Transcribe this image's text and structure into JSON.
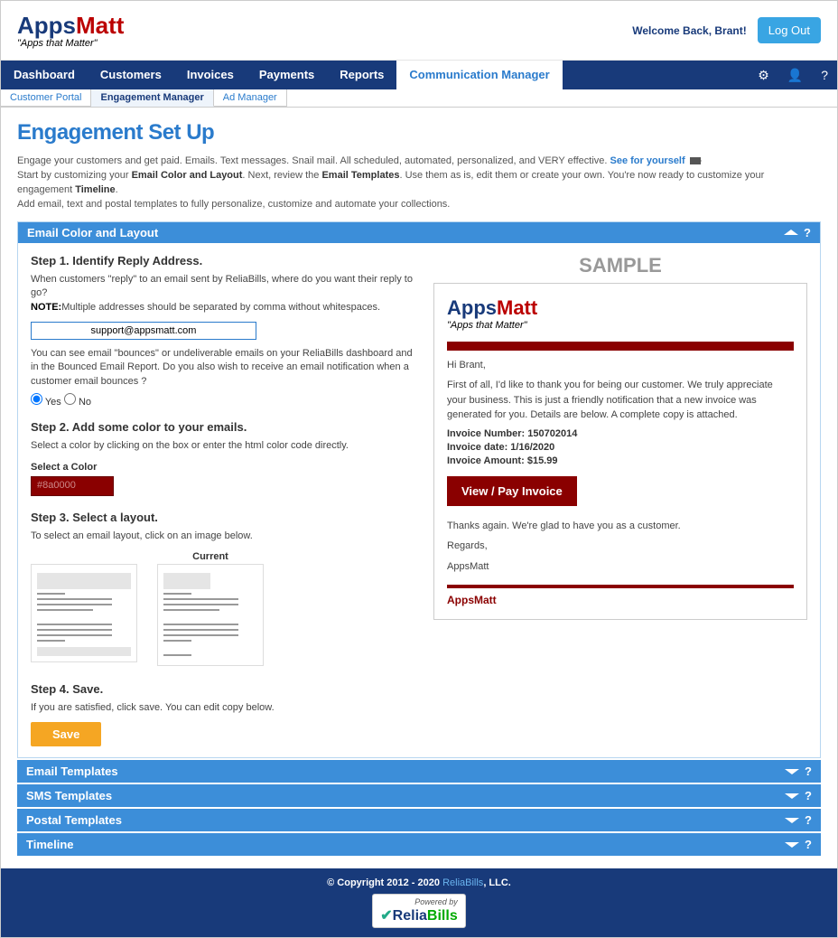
{
  "brand": {
    "apps": "Apps",
    "matt": "Matt",
    "tagline": "\"Apps that Matter\""
  },
  "header": {
    "welcome": "Welcome Back, Brant!",
    "logout": "Log Out"
  },
  "nav": {
    "items": [
      "Dashboard",
      "Customers",
      "Invoices",
      "Payments",
      "Reports",
      "Communication Manager"
    ],
    "active": 5
  },
  "subnav": {
    "items": [
      "Customer Portal",
      "Engagement Manager",
      "Ad Manager"
    ],
    "active": 1
  },
  "page": {
    "title": "Engagement Set Up",
    "intro1": "Engage your customers and get paid. Emails. Text messages. Snail mail. All scheduled, automated, personalized, and VERY effective. ",
    "see": "See for yourself",
    "intro2a": "Start by customizing your ",
    "intro2b": "Email Color and Layout",
    "intro2c": ". Next, review the ",
    "intro2d": "Email Templates",
    "intro2e": ". Use them as is, edit them or create your own. You're now ready to customize your engagement ",
    "intro2f": "Timeline",
    "intro2g": ".",
    "intro3": "Add email, text and postal templates to fully personalize, customize and automate your collections."
  },
  "panel": {
    "head": "Email Color and Layout",
    "step1": {
      "title": "Step 1. Identify Reply Address.",
      "text1": "When customers \"reply\" to an email sent by ReliaBills, where do you want their reply to go?",
      "note_label": "NOTE:",
      "note": "Multiple addresses should be separated by comma without whitespaces.",
      "value": "support@appsmatt.com",
      "text2": "You can see email \"bounces\" or undeliverable emails on your ReliaBills dashboard and in the Bounced Email Report. Do you also wish to receive an email notification when a customer email bounces ?",
      "yes": "Yes",
      "no": "No"
    },
    "step2": {
      "title": "Step 2. Add some color to your emails.",
      "text": "Select a color by clicking on the box or enter the html color code directly.",
      "label": "Select a Color",
      "value": "#8a0000"
    },
    "step3": {
      "title": "Step 3. Select a layout.",
      "text": "To select an email layout, click on an image below.",
      "current": "Current"
    },
    "step4": {
      "title": "Step 4. Save.",
      "text": "If you are satisfied, click save. You can edit copy below.",
      "button": "Save"
    }
  },
  "sample": {
    "title": "SAMPLE",
    "greet": "Hi Brant,",
    "body": "First of all, I'd like to thank you for being our customer. We truly appreciate your business. This is just a friendly notification that a new invoice was generated for you. Details are below. A complete copy is attached.",
    "inv_num_label": "Invoice Number: ",
    "inv_num": "150702014",
    "inv_date_label": "Invoice date: ",
    "inv_date": "1/16/2020",
    "inv_amt_label": "Invoice Amount: ",
    "inv_amt": "$15.99",
    "button": "View / Pay Invoice",
    "thanks": "Thanks again. We're glad to have you as a customer.",
    "regards": "Regards,",
    "signoff": "AppsMatt",
    "footer": "AppsMatt"
  },
  "accordions": [
    "Email Templates",
    "SMS Templates",
    "Postal Templates",
    "Timeline"
  ],
  "footer": {
    "copy": "© Copyright 2012 - 2020 ",
    "relia": "ReliaBills",
    "llc": ", LLC.",
    "powered": "Powered by"
  }
}
